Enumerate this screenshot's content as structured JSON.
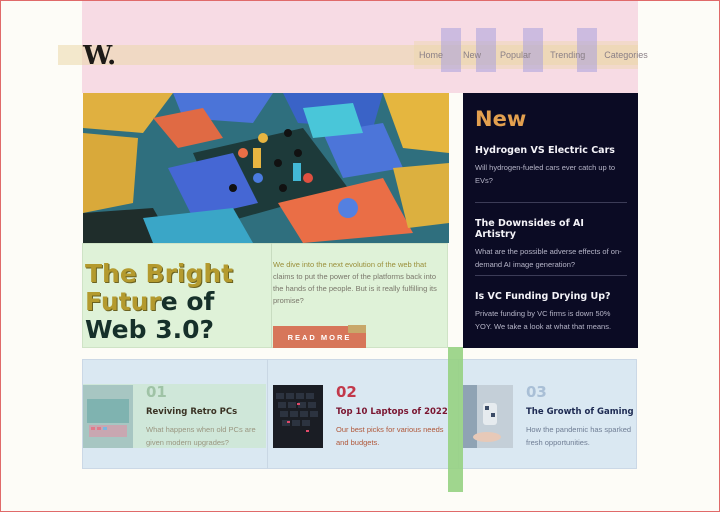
{
  "header": {
    "logo": "W.",
    "nav": [
      "Home",
      "New",
      "Popular",
      "Trending",
      "Categories"
    ]
  },
  "hero": {
    "image": "abstract-3d-blocks-image",
    "title_hl_1": "The Bright",
    "title_hl_2": "Futur",
    "title_rest_1": "e of",
    "title_rest_2": "Web 3.0?",
    "desc_accent": "We dive into the next evolution of the web that",
    "desc_rest": "claims to put the power of the platforms back into the hands of the people. But is it really fulfilling its promise?",
    "button": "READ MORE"
  },
  "new_panel": {
    "heading": "New",
    "items": [
      {
        "title": "Hydrogen VS Electric Cars",
        "desc": "Will hydrogen-fueled cars ever catch up to EVs?"
      },
      {
        "title": "The Downsides of AI Artistry",
        "desc": "What are the possible adverse effects of on-demand AI image generation?"
      },
      {
        "title": "Is VC Funding Drying Up?",
        "desc": "Private funding by VC firms is down 50% YOY. We take a look at what that means."
      }
    ]
  },
  "cards": [
    {
      "num": "01",
      "title": "Reviving Retro PCs",
      "desc": "What happens when old PCs are given modern upgrades?",
      "image": "retro-pc-image"
    },
    {
      "num": "02",
      "title": "Top 10 Laptops of 2022",
      "desc": "Our best picks for various needs and budgets.",
      "image": "laptop-keyboard-image"
    },
    {
      "num": "03",
      "title": "The Growth of Gaming",
      "desc": "How the pandemic has sparked fresh opportunities.",
      "image": "gaming-controller-image"
    }
  ],
  "colors": {
    "accent_orange": "#e3a04f",
    "navy": "#0b0b24",
    "button": "#d7765a",
    "num_red": "#c2384a"
  }
}
